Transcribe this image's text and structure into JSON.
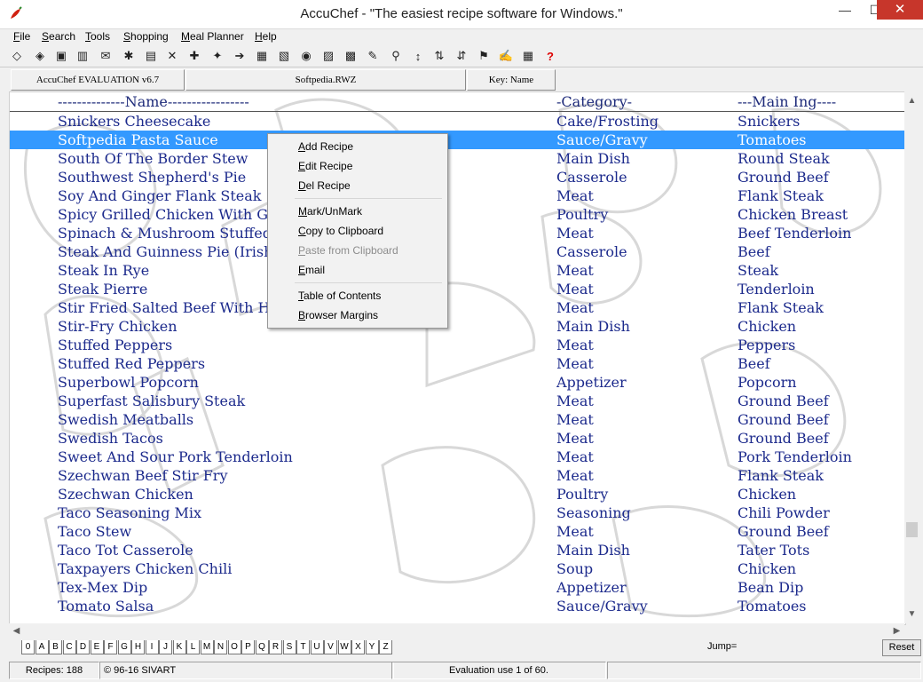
{
  "window": {
    "title": "AccuChef - \"The easiest recipe software for Windows.\"",
    "min_glyph": "—",
    "max_glyph": "☐",
    "close_glyph": "✕"
  },
  "menu": [
    {
      "label": "File",
      "accel": "F",
      "rest": "ile"
    },
    {
      "label": "Search",
      "accel": "S",
      "rest": "earch"
    },
    {
      "label": "Tools",
      "accel": "T",
      "rest": "ools"
    },
    {
      "label": "Shopping",
      "accel": "S",
      "rest": "hopping"
    },
    {
      "label": "Meal Planner",
      "accel": "M",
      "rest": "eal Planner"
    },
    {
      "label": "Help",
      "accel": "H",
      "rest": "elp"
    }
  ],
  "infobar": {
    "version": "AccuChef EVALUATION v6.7",
    "file": "Softpedia.RWZ",
    "key": "Key: Name"
  },
  "columns": {
    "name": "--------------Name-----------------",
    "category": "-Category-",
    "ingredient": "---Main Ing----"
  },
  "rows": [
    {
      "name": "Snickers Cheesecake",
      "category": "Cake/Frosting",
      "ingredient": "Snickers"
    },
    {
      "name": "Softpedia Pasta Sauce",
      "category": "Sauce/Gravy",
      "ingredient": "Tomatoes"
    },
    {
      "name": "South Of The Border Stew",
      "category": "Main Dish",
      "ingredient": "Round Steak"
    },
    {
      "name": "Southwest Shepherd's Pie",
      "category": "Casserole",
      "ingredient": "Ground Beef"
    },
    {
      "name": "Soy And Ginger Flank Steak",
      "category": "Meat",
      "ingredient": "Flank Steak"
    },
    {
      "name": "Spicy Grilled Chicken With Gr",
      "category": "Poultry",
      "ingredient": "Chicken Breast"
    },
    {
      "name": "Spinach & Mushroom Stuffed",
      "category": "Meat",
      "ingredient": "Beef Tenderloin"
    },
    {
      "name": "Steak And Guinness Pie (Irish",
      "category": "Casserole",
      "ingredient": "Beef"
    },
    {
      "name": "Steak In Rye",
      "category": "Meat",
      "ingredient": "Steak"
    },
    {
      "name": "Steak Pierre",
      "category": "Meat",
      "ingredient": "Tenderloin"
    },
    {
      "name": "Stir Fried Salted Beef With Ho",
      "category": "Meat",
      "ingredient": "Flank Steak"
    },
    {
      "name": "Stir-Fry Chicken",
      "category": "Main Dish",
      "ingredient": "Chicken"
    },
    {
      "name": "Stuffed Peppers",
      "category": "Meat",
      "ingredient": "Peppers"
    },
    {
      "name": "Stuffed Red Peppers",
      "category": "Meat",
      "ingredient": "Beef"
    },
    {
      "name": "Superbowl Popcorn",
      "category": "Appetizer",
      "ingredient": "Popcorn"
    },
    {
      "name": "Superfast Salisbury Steak",
      "category": "Meat",
      "ingredient": "Ground Beef"
    },
    {
      "name": "Swedish Meatballs",
      "category": "Meat",
      "ingredient": "Ground Beef"
    },
    {
      "name": "Swedish Tacos",
      "category": "Meat",
      "ingredient": "Ground Beef"
    },
    {
      "name": "Sweet And Sour Pork Tenderloin",
      "category": "Meat",
      "ingredient": "Pork Tenderloin"
    },
    {
      "name": "Szechwan Beef Stir Fry",
      "category": "Meat",
      "ingredient": "Flank Steak"
    },
    {
      "name": "Szechwan Chicken",
      "category": "Poultry",
      "ingredient": "Chicken"
    },
    {
      "name": "Taco Seasoning Mix",
      "category": "Seasoning",
      "ingredient": "Chili Powder"
    },
    {
      "name": "Taco Stew",
      "category": "Meat",
      "ingredient": "Ground Beef"
    },
    {
      "name": "Taco Tot Casserole",
      "category": "Main Dish",
      "ingredient": "Tater Tots"
    },
    {
      "name": "Taxpayers Chicken Chili",
      "category": "Soup",
      "ingredient": "Chicken"
    },
    {
      "name": "Tex-Mex Dip",
      "category": "Appetizer",
      "ingredient": "Bean Dip"
    },
    {
      "name": "Tomato Salsa",
      "category": "Sauce/Gravy",
      "ingredient": "Tomatoes"
    }
  ],
  "selected_row": 1,
  "context_menu": [
    {
      "label": "Add Recipe",
      "accel": "A",
      "rest": "dd Recipe",
      "disabled": false
    },
    {
      "label": "Edit Recipe",
      "accel": "E",
      "rest": "dit Recipe",
      "disabled": false
    },
    {
      "label": "Del Recipe",
      "accel": "D",
      "rest": "el Recipe",
      "disabled": false
    },
    {
      "label": "Mark/UnMark",
      "accel": "M",
      "rest": "ark/UnMark",
      "disabled": false
    },
    {
      "label": "Copy to Clipboard",
      "accel": "C",
      "rest": "opy to Clipboard",
      "disabled": false
    },
    {
      "label": "Paste from Clipboard",
      "accel": "P",
      "rest": "aste from Clipboard",
      "disabled": true
    },
    {
      "label": "Email",
      "accel": "E",
      "rest": "mail",
      "disabled": false
    },
    {
      "label": "Table of Contents",
      "accel": "T",
      "rest": "able of Contents",
      "disabled": false
    },
    {
      "label": "Browser Margins",
      "accel": "B",
      "rest": "rowser Margins",
      "disabled": false
    }
  ],
  "alphabet": [
    "0",
    "A",
    "B",
    "C",
    "D",
    "E",
    "F",
    "G",
    "H",
    "I",
    "J",
    "K",
    "L",
    "M",
    "N",
    "O",
    "P",
    "Q",
    "R",
    "S",
    "T",
    "U",
    "V",
    "W",
    "X",
    "Y",
    "Z"
  ],
  "jump_label": "Jump=",
  "reset_label": "Reset",
  "status": {
    "recipes": "Recipes: 188",
    "copyright": "© 96-16 SIVART",
    "evaluation": "Evaluation use 1 of 60."
  },
  "toolbar_icons": [
    "open-book-icon",
    "save-icon",
    "trash-icon",
    "mail-icon",
    "tools-icon",
    "print-list-icon",
    "cut-icon",
    "add-recipe-icon",
    "wand-icon",
    "export-icon",
    "printer-icon",
    "printer-2-icon",
    "view-icon",
    "card-icon",
    "card-2-icon",
    "filter-icon",
    "search-recipe-icon",
    "sort-az-icon",
    "sort-za-icon",
    "sort-az-2-icon",
    "cart-icon",
    "notes-icon",
    "calendar-icon",
    "help-icon"
  ],
  "colors": {
    "selection": "#3399ff",
    "list_text": "#1c2a8c",
    "close_button": "#c7362b"
  }
}
